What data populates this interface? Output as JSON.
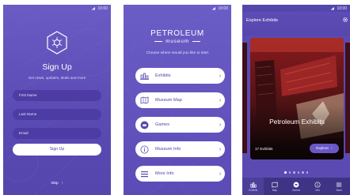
{
  "signup": {
    "time": "10:00",
    "title": "Sign Up",
    "subtitle": "Get news, updates, deals and more",
    "first_name_placeholder": "First Name",
    "last_name_placeholder": "Last Name",
    "email_placeholder": "Email",
    "signup_button": "Sign Up",
    "skip_label": "Skip",
    "skip_arrow": "›"
  },
  "menu": {
    "time": "10:00",
    "logo_line1": "PETROLEUM",
    "logo_line2": "museum",
    "prompt": "Choose where would you like to start",
    "items": [
      {
        "label": "Exhibits",
        "icon": "building-chart-icon"
      },
      {
        "label": "Museum Map",
        "icon": "map-icon"
      },
      {
        "label": "Games",
        "icon": "gamepad-icon"
      },
      {
        "label": "Museum Info",
        "icon": "info-icon"
      },
      {
        "label": "More Info",
        "icon": "menu-lines-icon"
      }
    ],
    "chevron": "›"
  },
  "explore": {
    "time": "10:00",
    "title": "Explore Exhibits",
    "card_title": "Petroleum Exhibits",
    "card_count": "17 Exhibits",
    "explore_button": "Explore",
    "explore_arrow": "›",
    "tabs": [
      {
        "label": "Exhibits",
        "icon": "chart-icon"
      },
      {
        "label": "Map",
        "icon": "map-icon"
      },
      {
        "label": "Games",
        "icon": "gamepad-icon"
      },
      {
        "label": "Info",
        "icon": "info-icon"
      },
      {
        "label": "More",
        "icon": "menu-lines-icon"
      }
    ]
  },
  "colors": {
    "brand_purple": "#5a4ab0",
    "tab_bar": "#3f3385",
    "button_text": "#4d3fa8"
  }
}
